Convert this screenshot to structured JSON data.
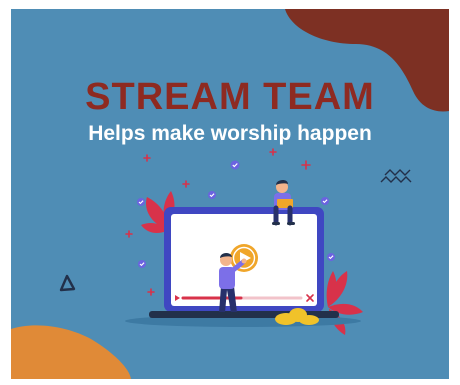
{
  "heading": {
    "title": "STREAM TEAM",
    "subtitle": "Helps make worship happen"
  },
  "colors": {
    "background": "#4f8db5",
    "title": "#8e2a21",
    "subtitle": "#ffffff",
    "accent_blob_top": "#7d3023",
    "accent_blob_bottom": "#e08a37",
    "laptop_frame": "#3f47c2",
    "play_button": "#f0a62a",
    "leaves": "#d8324a",
    "progress": "#d8324a"
  },
  "icons": {
    "play": "play-icon",
    "close": "close-icon",
    "triangle": "triangle-outline-icon",
    "zigzag": "zigzag-icon"
  }
}
